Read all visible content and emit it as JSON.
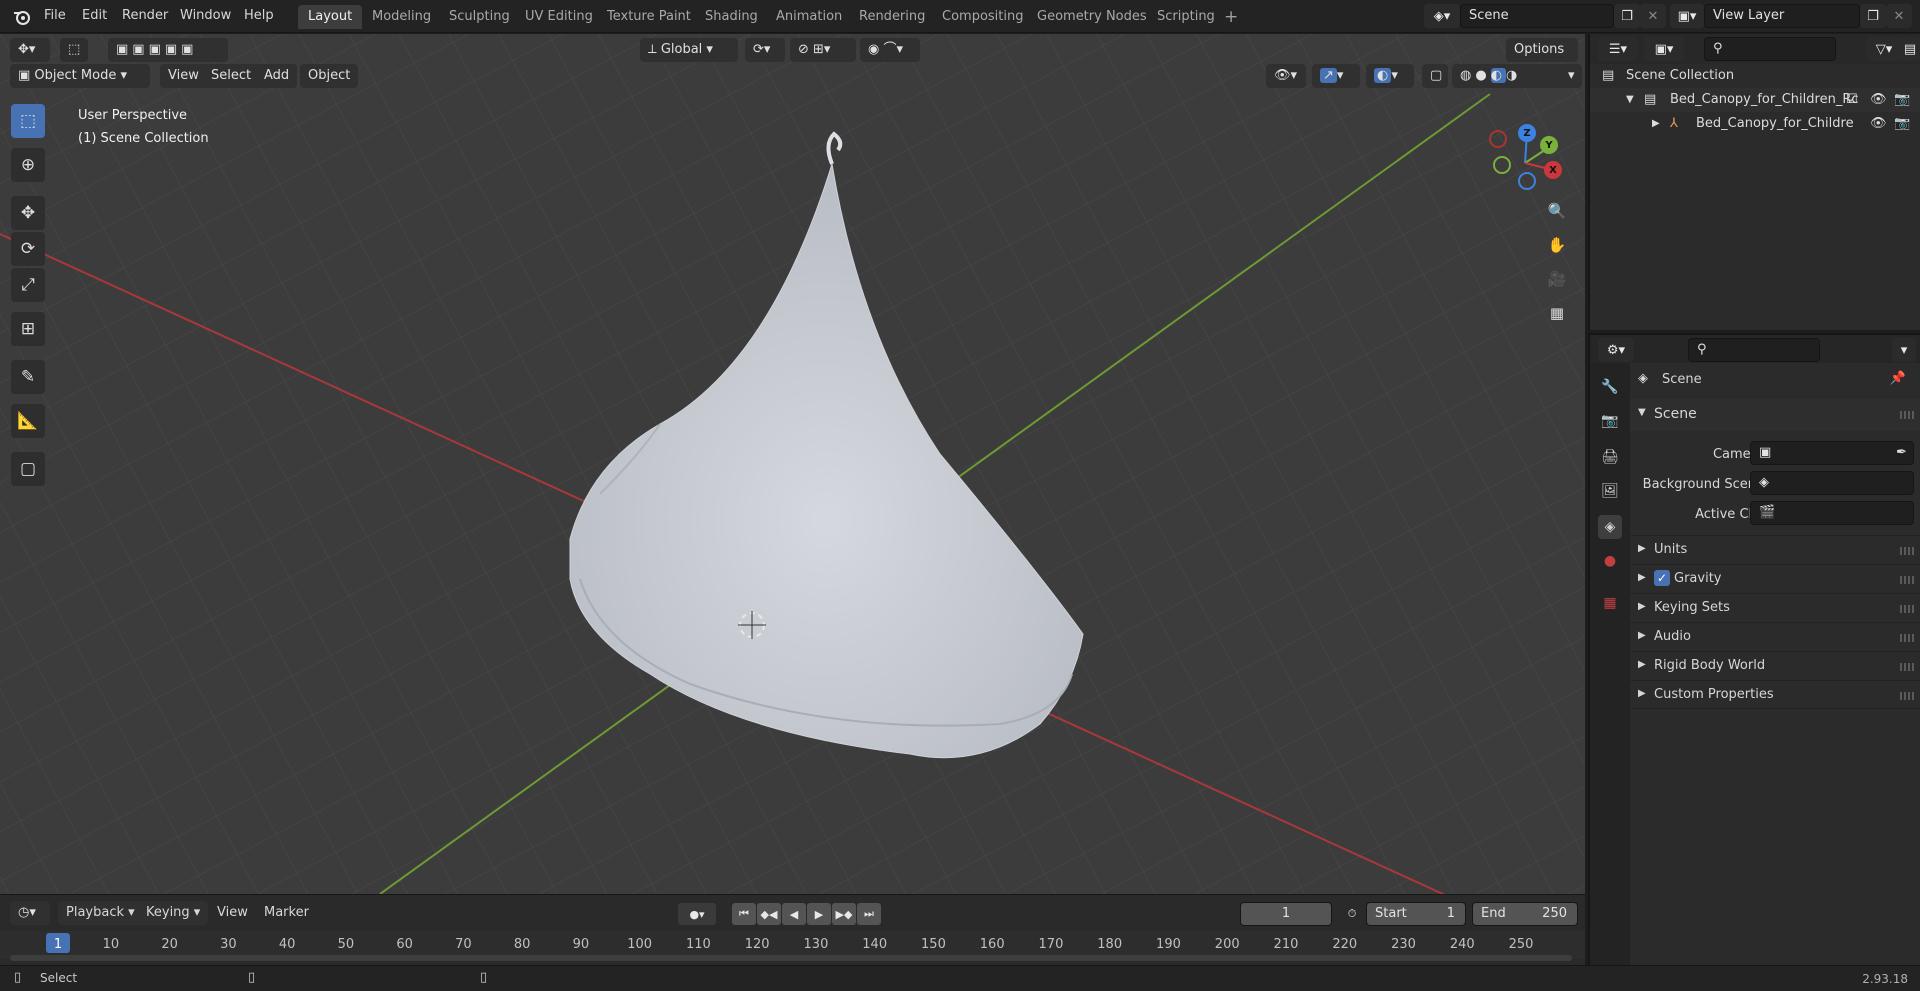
{
  "app": {
    "version": "2.93.18"
  },
  "menu": {
    "items": [
      "File",
      "Edit",
      "Render",
      "Window",
      "Help"
    ]
  },
  "workspaces": [
    "Layout",
    "Modeling",
    "Sculpting",
    "UV Editing",
    "Texture Paint",
    "Shading",
    "Animation",
    "Rendering",
    "Compositing",
    "Geometry Nodes",
    "Scripting"
  ],
  "active_workspace": "Layout",
  "scene_field": {
    "value": "Scene"
  },
  "view_layer_field": {
    "value": "View Layer"
  },
  "viewport": {
    "transform_orientation": "Global",
    "options_label": "Options",
    "mode": "Object Mode",
    "header_menu": [
      "View",
      "Select",
      "Add",
      "Object"
    ],
    "overlay_text": {
      "line1": "User Perspective",
      "line2": "(1) Scene Collection"
    },
    "gizmo_axes": {
      "x": "X",
      "y": "Y",
      "z": "Z"
    },
    "colors": {
      "x_axis": "#c8383c",
      "y_axis": "#7bb03c",
      "z_axis": "#3d82e0",
      "background": "#3c3c3c",
      "active_tool": "#4772b3"
    }
  },
  "timeline": {
    "menu": [
      "Playback",
      "Keying",
      "View",
      "Marker"
    ],
    "current_frame": "1",
    "start_label": "Start",
    "start_value": "1",
    "end_label": "End",
    "end_value": "250",
    "ruler": [
      "1",
      "10",
      "20",
      "30",
      "40",
      "50",
      "60",
      "70",
      "80",
      "90",
      "100",
      "110",
      "120",
      "130",
      "140",
      "150",
      "160",
      "170",
      "180",
      "190",
      "200",
      "210",
      "220",
      "230",
      "240",
      "250"
    ]
  },
  "statusbar": {
    "left_label": "Select"
  },
  "outliner": {
    "root": "Scene Collection",
    "items": [
      {
        "label": "Bed_Canopy_for_Children_Rc"
      },
      {
        "label": "Bed_Canopy_for_Childre"
      }
    ]
  },
  "properties": {
    "context_label": "Scene",
    "panel_title": "Scene",
    "fields": [
      {
        "label": "Camera"
      },
      {
        "label": "Background Scene"
      },
      {
        "label": "Active Clip"
      }
    ],
    "subpanels": [
      "Units",
      "Gravity",
      "Keying Sets",
      "Audio",
      "Rigid Body World",
      "Custom Properties"
    ],
    "gravity_checked": true
  }
}
